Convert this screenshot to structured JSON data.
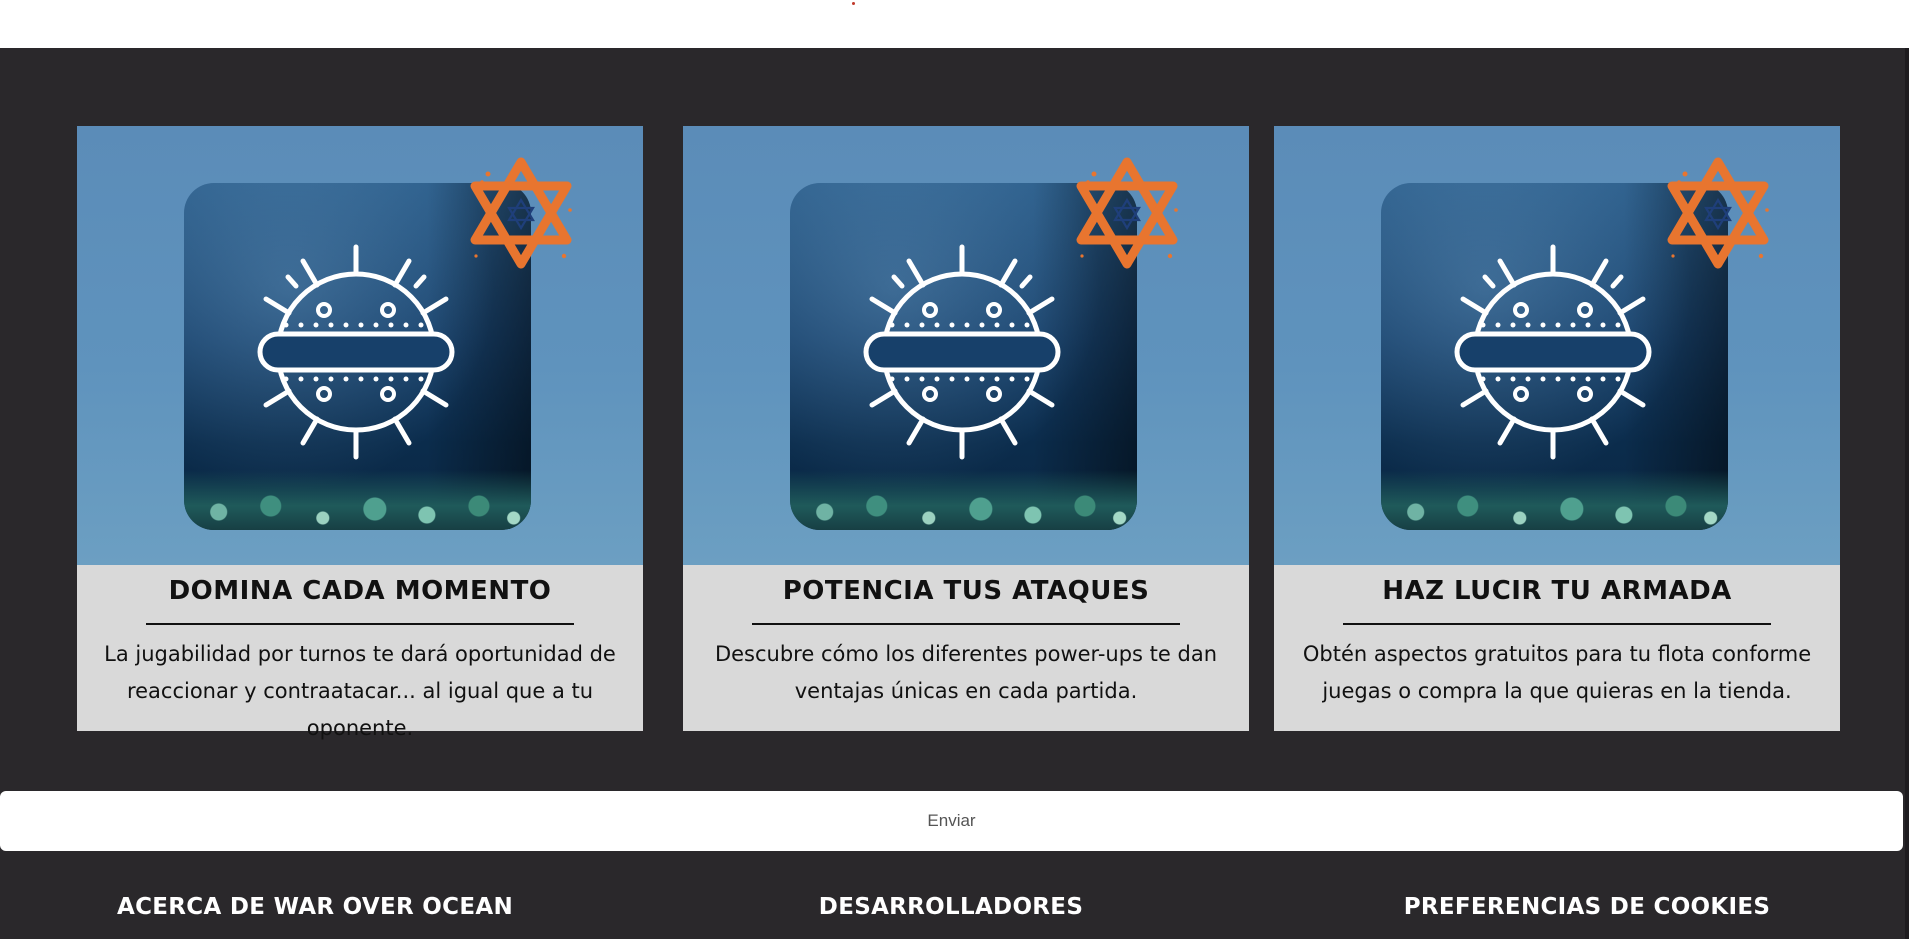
{
  "features": [
    {
      "title": "DOMINA CADA MOMENTO",
      "description_line1": "La jugabilidad por turnos te dará oportunidad de",
      "description_line2": "reaccionar y contraatacar... al igual que a tu oponente.",
      "icon": "naval-mine-icon",
      "badge_icon": "star-of-david-icon"
    },
    {
      "title": "POTENCIA TUS ATAQUES",
      "description_line1": "Descubre cómo los diferentes power-ups te dan",
      "description_line2": "ventajas únicas en cada partida.",
      "icon": "naval-mine-icon",
      "badge_icon": "star-of-david-icon"
    },
    {
      "title": "HAZ LUCIR TU ARMADA",
      "description_line1": "Obtén aspectos gratuitos para tu flota conforme",
      "description_line2": "juegas o compra la que quieras en la tienda.",
      "icon": "naval-mine-icon",
      "badge_icon": "star-of-david-icon"
    }
  ],
  "send_button": {
    "label": "Enviar"
  },
  "footer": {
    "links": [
      {
        "label": "ACERCA DE WAR OVER OCEAN"
      },
      {
        "label": "DESARROLLADORES"
      },
      {
        "label": "PREFERENCIAS DE COOKIES"
      }
    ]
  },
  "colors": {
    "background_dark": "#2a282b",
    "card_body": "#d9d9d9",
    "card_sky": "#5f93bd",
    "badge_orange": "#e8752f",
    "text_dark": "#111111",
    "text_light": "#ffffff"
  }
}
